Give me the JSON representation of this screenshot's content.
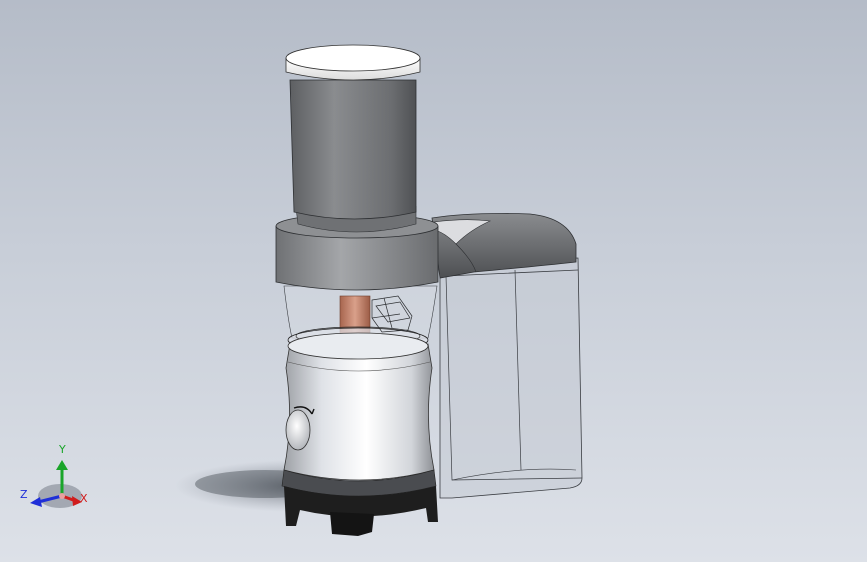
{
  "viewport": {
    "background_top": "#b5bcc8",
    "background_bottom": "#dde1e8"
  },
  "model": {
    "lid_color": "#f2f2f2",
    "chute_color": "#757779",
    "motor_housing_color": "#dcdcdc",
    "shaft_color": "#c98a72",
    "base_feet_color": "#1e1e1e",
    "dial_icon": "dial-knob-icon"
  },
  "triad": {
    "x_label": "X",
    "y_label": "Y",
    "z_label": "Z",
    "x_color": "#d01c1c",
    "y_color": "#1aa52a",
    "z_color": "#1f2fd8"
  }
}
